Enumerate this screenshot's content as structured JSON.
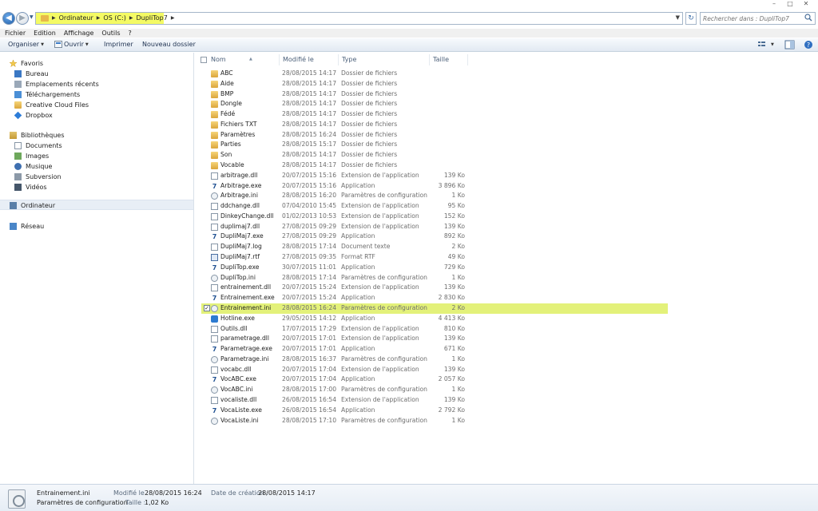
{
  "window": {
    "minimize": "–",
    "maximize": "□",
    "close": "✕"
  },
  "address": {
    "crumbs": [
      "Ordinateur",
      "OS (C:)",
      "DupliTop7"
    ]
  },
  "search": {
    "placeholder": "Rechercher dans : DupliTop7"
  },
  "menu": [
    "Fichier",
    "Edition",
    "Affichage",
    "Outils",
    "?"
  ],
  "toolbar": {
    "organize": "Organiser",
    "open": "Ouvrir",
    "print": "Imprimer",
    "new_folder": "Nouveau dossier"
  },
  "navpane": {
    "favorites": {
      "label": "Favoris",
      "items": [
        "Bureau",
        "Emplacements récents",
        "Téléchargements",
        "Creative Cloud Files",
        "Dropbox"
      ]
    },
    "libraries": {
      "label": "Bibliothèques",
      "items": [
        "Documents",
        "Images",
        "Musique",
        "Subversion",
        "Vidéos"
      ]
    },
    "computer": "Ordinateur",
    "network": "Réseau"
  },
  "columns": {
    "name": "Nom",
    "modified": "Modifié le",
    "type": "Type",
    "size": "Taille"
  },
  "files": [
    {
      "name": "ABC",
      "date": "28/08/2015 14:17",
      "type": "Dossier de fichiers",
      "size": "",
      "icon": "folder"
    },
    {
      "name": "Aide",
      "date": "28/08/2015 14:17",
      "type": "Dossier de fichiers",
      "size": "",
      "icon": "folder"
    },
    {
      "name": "BMP",
      "date": "28/08/2015 14:17",
      "type": "Dossier de fichiers",
      "size": "",
      "icon": "folder"
    },
    {
      "name": "Dongle",
      "date": "28/08/2015 14:17",
      "type": "Dossier de fichiers",
      "size": "",
      "icon": "folder"
    },
    {
      "name": "Fédé",
      "date": "28/08/2015 14:17",
      "type": "Dossier de fichiers",
      "size": "",
      "icon": "folder"
    },
    {
      "name": "Fichiers TXT",
      "date": "28/08/2015 14:17",
      "type": "Dossier de fichiers",
      "size": "",
      "icon": "folder"
    },
    {
      "name": "Paramètres",
      "date": "28/08/2015 16:24",
      "type": "Dossier de fichiers",
      "size": "",
      "icon": "folder"
    },
    {
      "name": "Parties",
      "date": "28/08/2015 15:17",
      "type": "Dossier de fichiers",
      "size": "",
      "icon": "folder"
    },
    {
      "name": "Son",
      "date": "28/08/2015 14:17",
      "type": "Dossier de fichiers",
      "size": "",
      "icon": "folder"
    },
    {
      "name": "Vocable",
      "date": "28/08/2015 14:17",
      "type": "Dossier de fichiers",
      "size": "",
      "icon": "folder"
    },
    {
      "name": "arbitrage.dll",
      "date": "20/07/2015 15:16",
      "type": "Extension de l'application",
      "size": "139 Ko",
      "icon": "file"
    },
    {
      "name": "Arbitrage.exe",
      "date": "20/07/2015 15:16",
      "type": "Application",
      "size": "3 896 Ko",
      "icon": "exe"
    },
    {
      "name": "Arbitrage.ini",
      "date": "28/08/2015 16:20",
      "type": "Paramètres de configuration",
      "size": "1 Ko",
      "icon": "ini"
    },
    {
      "name": "ddchange.dll",
      "date": "07/04/2010 15:45",
      "type": "Extension de l'application",
      "size": "95 Ko",
      "icon": "file"
    },
    {
      "name": "DinkeyChange.dll",
      "date": "01/02/2013 10:53",
      "type": "Extension de l'application",
      "size": "152 Ko",
      "icon": "file"
    },
    {
      "name": "duplimaj7.dll",
      "date": "27/08/2015 09:29",
      "type": "Extension de l'application",
      "size": "139 Ko",
      "icon": "file"
    },
    {
      "name": "DupliMaj7.exe",
      "date": "27/08/2015 09:29",
      "type": "Application",
      "size": "892 Ko",
      "icon": "exe"
    },
    {
      "name": "DupliMaj7.log",
      "date": "28/08/2015 17:14",
      "type": "Document texte",
      "size": "2 Ko",
      "icon": "file"
    },
    {
      "name": "DupliMaj7.rtf",
      "date": "27/08/2015 09:35",
      "type": "Format RTF",
      "size": "49 Ko",
      "icon": "rtf"
    },
    {
      "name": "DupliTop.exe",
      "date": "30/07/2015 11:01",
      "type": "Application",
      "size": "729 Ko",
      "icon": "exe"
    },
    {
      "name": "DupliTop.ini",
      "date": "28/08/2015 17:14",
      "type": "Paramètres de configuration",
      "size": "1 Ko",
      "icon": "ini"
    },
    {
      "name": "entrainement.dll",
      "date": "20/07/2015 15:24",
      "type": "Extension de l'application",
      "size": "139 Ko",
      "icon": "file"
    },
    {
      "name": "Entrainement.exe",
      "date": "20/07/2015 15:24",
      "type": "Application",
      "size": "2 830 Ko",
      "icon": "exe"
    },
    {
      "name": "Entrainement.ini",
      "date": "28/08/2015 16:24",
      "type": "Paramètres de configuration",
      "size": "2 Ko",
      "icon": "ini",
      "selected": true
    },
    {
      "name": "Hotline.exe",
      "date": "29/05/2015 14:12",
      "type": "Application",
      "size": "4 413 Ko",
      "icon": "hotline"
    },
    {
      "name": "Outils.dll",
      "date": "17/07/2015 17:29",
      "type": "Extension de l'application",
      "size": "810 Ko",
      "icon": "file"
    },
    {
      "name": "parametrage.dll",
      "date": "20/07/2015 17:01",
      "type": "Extension de l'application",
      "size": "139 Ko",
      "icon": "file"
    },
    {
      "name": "Parametrage.exe",
      "date": "20/07/2015 17:01",
      "type": "Application",
      "size": "671 Ko",
      "icon": "exe"
    },
    {
      "name": "Parametrage.ini",
      "date": "28/08/2015 16:37",
      "type": "Paramètres de configuration",
      "size": "1 Ko",
      "icon": "ini"
    },
    {
      "name": "vocabc.dll",
      "date": "20/07/2015 17:04",
      "type": "Extension de l'application",
      "size": "139 Ko",
      "icon": "file"
    },
    {
      "name": "VocABC.exe",
      "date": "20/07/2015 17:04",
      "type": "Application",
      "size": "2 057 Ko",
      "icon": "exe"
    },
    {
      "name": "VocABC.ini",
      "date": "28/08/2015 17:00",
      "type": "Paramètres de configuration",
      "size": "1 Ko",
      "icon": "ini"
    },
    {
      "name": "vocaliste.dll",
      "date": "26/08/2015 16:54",
      "type": "Extension de l'application",
      "size": "139 Ko",
      "icon": "file"
    },
    {
      "name": "VocaListe.exe",
      "date": "26/08/2015 16:54",
      "type": "Application",
      "size": "2 792 Ko",
      "icon": "exe"
    },
    {
      "name": "VocaListe.ini",
      "date": "28/08/2015 17:10",
      "type": "Paramètres de configuration",
      "size": "1 Ko",
      "icon": "ini"
    }
  ],
  "details": {
    "name": "Entrainement.ini",
    "type": "Paramètres de configuration",
    "modified_label": "Modifié le :",
    "modified_value": "28/08/2015 16:24",
    "size_label": "Taille :",
    "size_value": "1,02 Ko",
    "created_label": "Date de création :",
    "created_value": "28/08/2015 14:17"
  },
  "colors": {
    "highlight": "#e3f17a",
    "address_highlight": "#f4fa64"
  }
}
